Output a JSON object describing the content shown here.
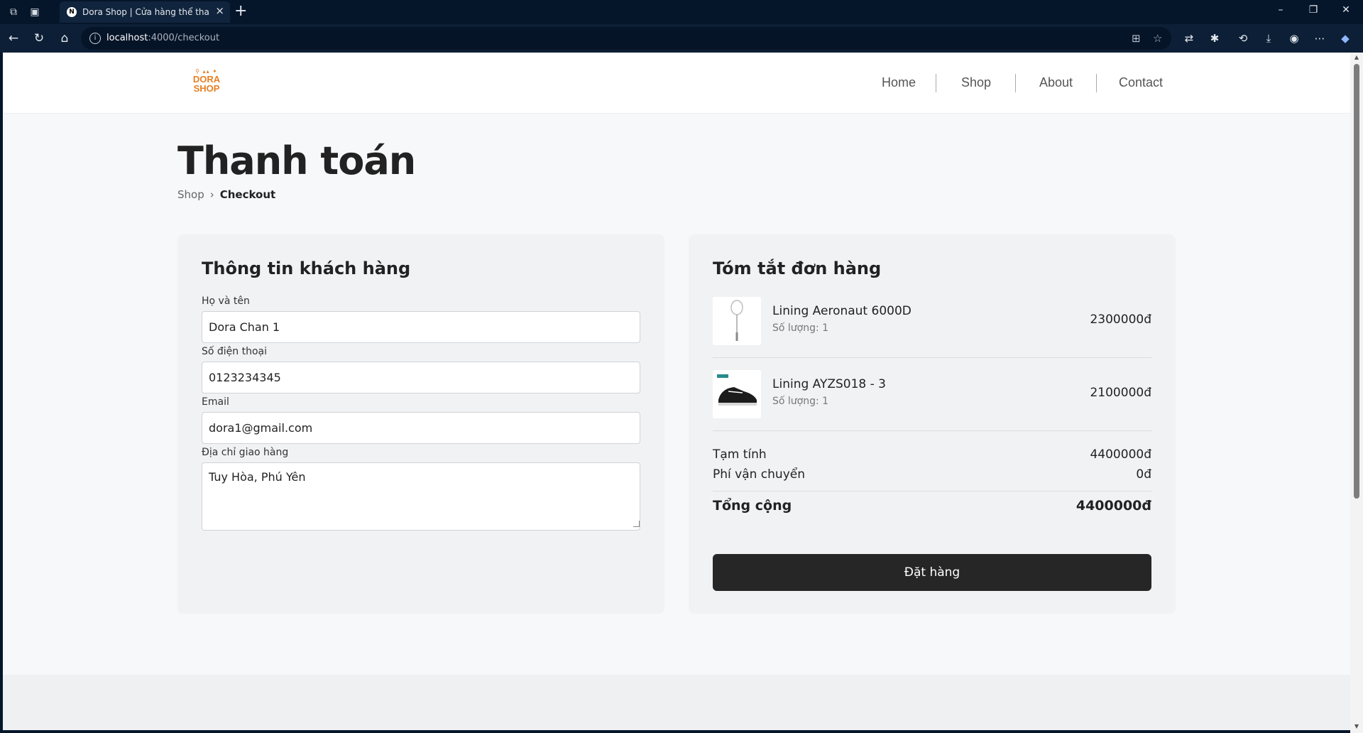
{
  "browser": {
    "tab_title": "Dora Shop | Cửa hàng thể thao tr",
    "tab_favicon": "N",
    "url_host": "localhost",
    "url_path": ":4000/checkout"
  },
  "header": {
    "logo_text": [
      "DORA",
      "SHOP"
    ],
    "nav": [
      "Home",
      "Shop",
      "About",
      "Contact"
    ]
  },
  "page": {
    "title": "Thanh toán",
    "breadcrumb": {
      "parent": "Shop",
      "current": "Checkout"
    }
  },
  "customer": {
    "title": "Thông tin khách hàng",
    "name_label": "Họ và tên",
    "name_value": "Dora Chan 1",
    "phone_label": "Số điện thoại",
    "phone_value": "0123234345",
    "email_label": "Email",
    "email_value": "dora1@gmail.com",
    "address_label": "Địa chỉ giao hàng",
    "address_value": "Tuy Hòa, Phú Yên"
  },
  "summary": {
    "title": "Tóm tắt đơn hàng",
    "items": [
      {
        "name": "Lining Aeronaut 6000D",
        "qty": "Số lượng: 1",
        "price": "2300000đ",
        "thumb_icon": "badminton-racket-icon"
      },
      {
        "name": "Lining AYZS018 - 3",
        "qty": "Số lượng: 1",
        "price": "2100000đ",
        "thumb_icon": "shoe-icon"
      }
    ],
    "subtotal_label": "Tạm tính",
    "subtotal_value": "4400000đ",
    "shipping_label": "Phí vận chuyển",
    "shipping_value": "0đ",
    "total_label": "Tổng cộng",
    "total_value": "4400000đ",
    "order_button": "Đặt hàng"
  },
  "colors": {
    "brand": "#e67e22",
    "button_bg": "#262626",
    "page_bg": "#f7f8fa",
    "chrome_bg": "#06162a"
  }
}
